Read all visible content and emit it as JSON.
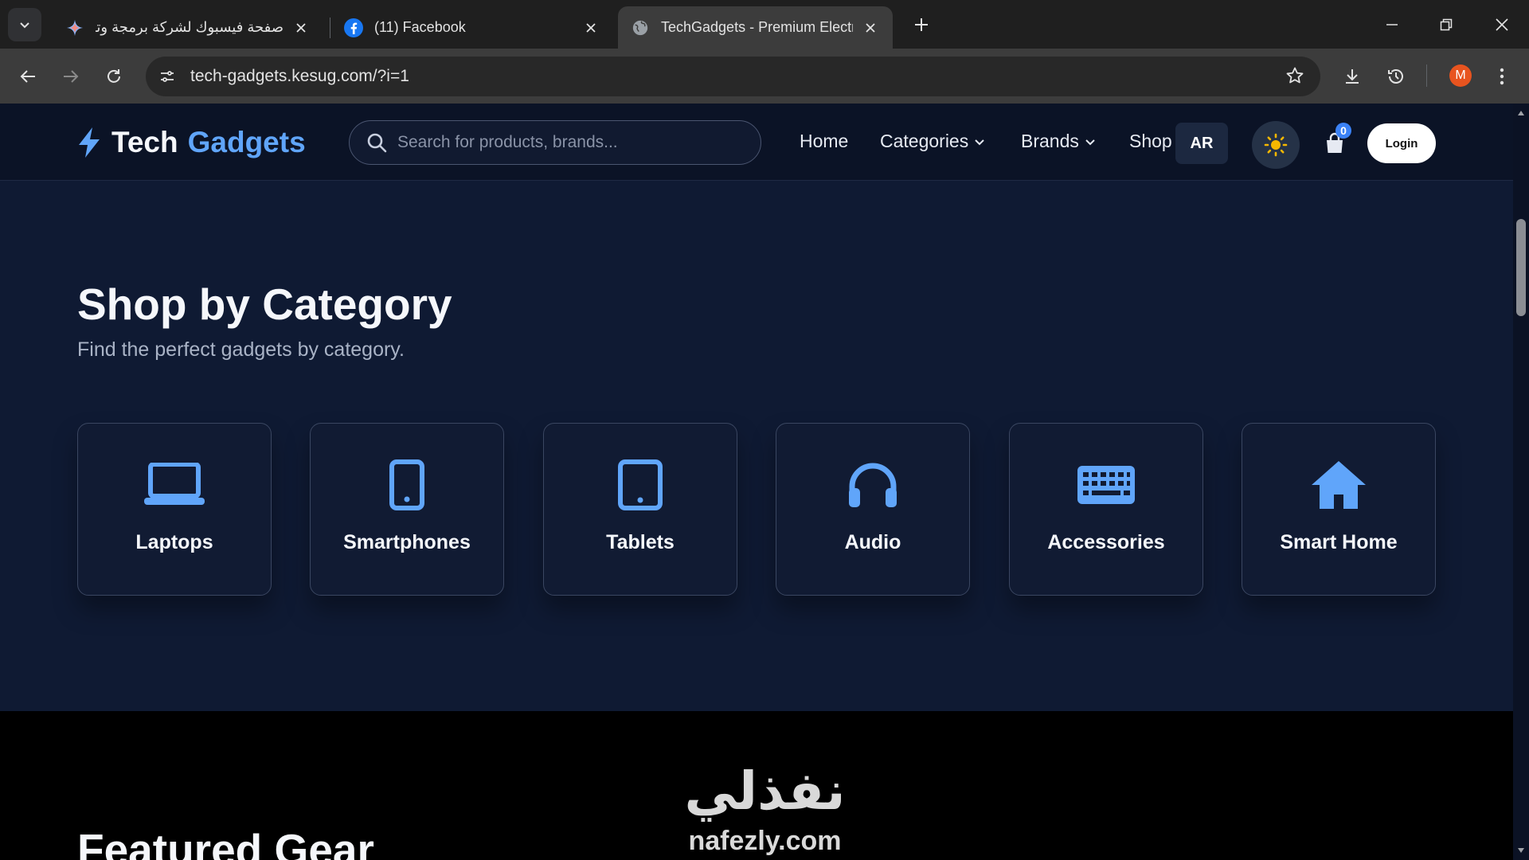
{
  "browser": {
    "tabs": [
      {
        "title": "صفحة فيسبوك لشركة برمجة وتصـ",
        "active": false,
        "icon": "gemini-sparkle-icon"
      },
      {
        "title": "(11) Facebook",
        "active": false,
        "icon": "facebook-icon"
      },
      {
        "title": "TechGadgets - Premium Electro",
        "active": true,
        "icon": "globe-icon"
      }
    ],
    "url": "tech-gadgets.kesug.com/?i=1",
    "profile_initial": "M"
  },
  "header": {
    "logo_word1": "Tech",
    "logo_word2": "Gadgets",
    "search_placeholder": "Search for products, brands...",
    "nav": {
      "home": "Home",
      "categories": "Categories",
      "brands": "Brands",
      "shop": "Shop"
    },
    "lang_button": "AR",
    "cart_count": "0",
    "login_label": "Login"
  },
  "categories_section": {
    "title": "Shop by Category",
    "subtitle": "Find the perfect gadgets by category.",
    "items": [
      {
        "label": "Laptops",
        "icon": "laptop-icon"
      },
      {
        "label": "Smartphones",
        "icon": "smartphone-icon"
      },
      {
        "label": "Tablets",
        "icon": "tablet-icon"
      },
      {
        "label": "Audio",
        "icon": "headphones-icon"
      },
      {
        "label": "Accessories",
        "icon": "keyboard-icon"
      },
      {
        "label": "Smart Home",
        "icon": "home-icon"
      }
    ]
  },
  "featured_section": {
    "title": "Featured Gear"
  },
  "watermark": {
    "arabic": "نفذلي",
    "latin": "nafezly.com"
  },
  "colors": {
    "accent": "#60a5fa",
    "page_bg": "#0f1a33",
    "header_bg": "#0b1326",
    "theme_icon": "#f5b700"
  }
}
